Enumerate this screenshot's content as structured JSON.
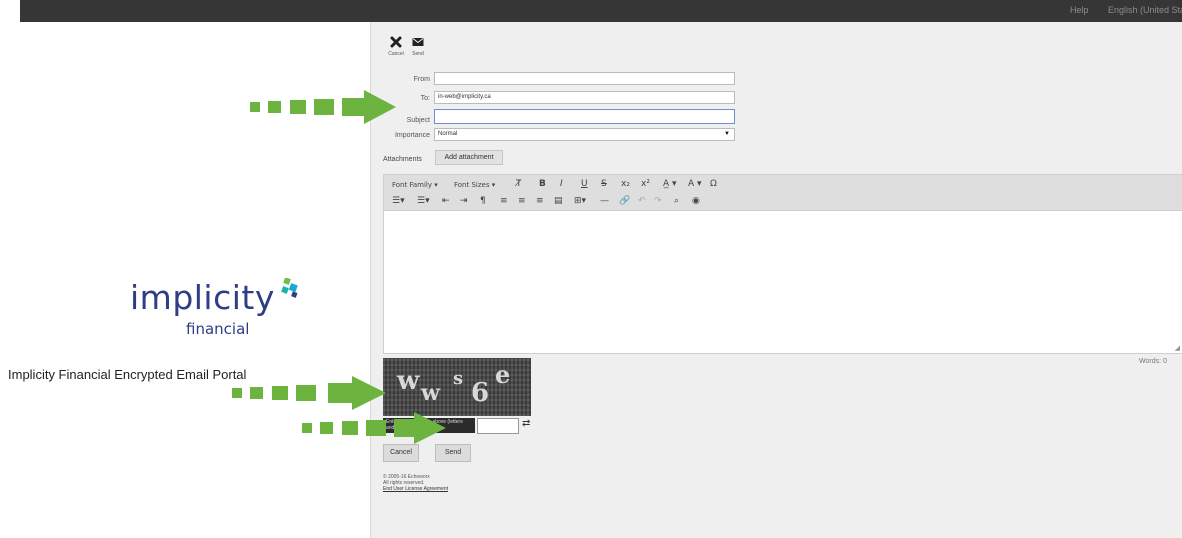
{
  "topbar": {
    "help": "Help",
    "language": "English (United States)"
  },
  "toolbar": {
    "cancel_label": "Cancel",
    "send_label": "Send",
    "cancel_icon": "close-x-icon",
    "send_icon": "envelope-icon"
  },
  "form": {
    "from_label": "From",
    "from_value": "",
    "to_label": "To:",
    "to_value": "in-web@implicity.ca",
    "subject_label": "Subject",
    "subject_value": "",
    "importance_label": "Importance",
    "importance_value": "Normal"
  },
  "attachments": {
    "label": "Attachments",
    "button": "Add attachment"
  },
  "editor": {
    "font_family": "Font Family",
    "font_sizes": "Font Sizes",
    "words": "Words: 0"
  },
  "captcha": {
    "chars": [
      "w",
      "w",
      "s",
      "6",
      "e"
    ],
    "instructions": "Enter the characters above (letters and numbers)",
    "input_value": ""
  },
  "buttons": {
    "cancel": "Cancel",
    "send": "Send"
  },
  "footer": {
    "line1": "© 2005-16 Echoworx",
    "line2": "All rights reserved.",
    "link": "End User License Agreement"
  },
  "branding": {
    "logo_word": "implicity",
    "logo_sub": "financial",
    "portal_title": "Implicity Financial Encrypted Email Portal"
  },
  "colors": {
    "arrow": "#6db33f",
    "logo": "#2e3d86",
    "topbar": "#363636"
  }
}
